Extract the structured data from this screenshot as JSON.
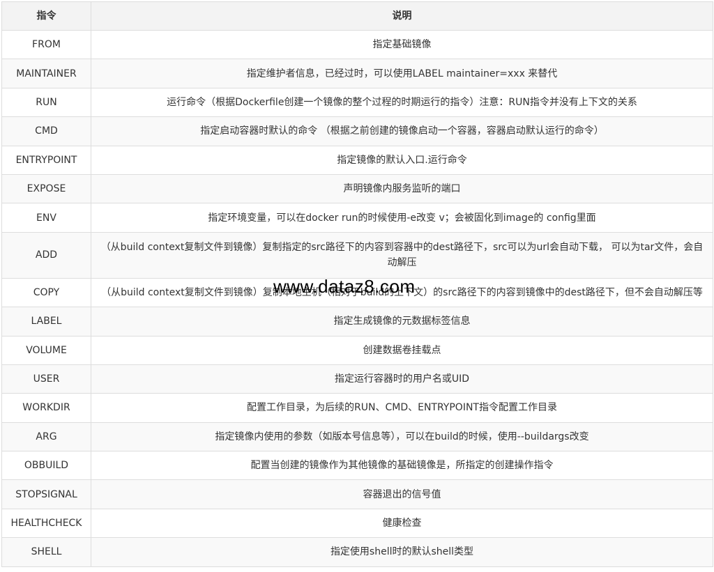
{
  "header": {
    "col1": "指令",
    "col2": "说明"
  },
  "rows": [
    {
      "cmd": "FROM",
      "desc": "指定基础镜像"
    },
    {
      "cmd": "MAINTAINER",
      "desc": "指定维护者信息，已经过时，可以使用LABEL maintainer=xxx 来替代"
    },
    {
      "cmd": "RUN",
      "desc": "运行命令（根据Dockerfile创建一个镜像的整个过程的时期运行的指令）注意：RUN指令并没有上下文的关系"
    },
    {
      "cmd": "CMD",
      "desc": "指定启动容器时默认的命令 （根据之前创建的镜像启动一个容器，容器启动默认运行的命令）"
    },
    {
      "cmd": "ENTRYPOINT",
      "desc": "指定镜像的默认入口.运行命令"
    },
    {
      "cmd": "EXPOSE",
      "desc": "声明镜像内服务监听的端口"
    },
    {
      "cmd": "ENV",
      "desc": "指定环境变量，可以在docker run的时候使用-e改变 v；会被固化到image的 config里面"
    },
    {
      "cmd": "ADD",
      "desc": "（从build context复制文件到镜像）复制指定的src路径下的内容到容器中的dest路径下，src可以为url会自动下载， 可以为tar文件，会自动解压"
    },
    {
      "cmd": "COPY",
      "desc": "（从build context复制文件到镜像）复制本地主机（相对于build的上下文）的src路径下的内容到镜像中的dest路径下，但不会自动解压等"
    },
    {
      "cmd": "LABEL",
      "desc": "指定生成镜像的元数据标签信息"
    },
    {
      "cmd": "VOLUME",
      "desc": "创建数据卷挂载点"
    },
    {
      "cmd": "USER",
      "desc": "指定运行容器时的用户名或UID"
    },
    {
      "cmd": "WORKDIR",
      "desc": "配置工作目录，为后续的RUN、CMD、ENTRYPOINT指令配置工作目录"
    },
    {
      "cmd": "ARG",
      "desc": "指定镜像内使用的参数（如版本号信息等），可以在build的时候，使用--buildargs改变"
    },
    {
      "cmd": "OBBUILD",
      "desc": "配置当创建的镜像作为其他镜像的基础镜像是，所指定的创建操作指令"
    },
    {
      "cmd": "STOPSIGNAL",
      "desc": "容器退出的信号值"
    },
    {
      "cmd": "HEALTHCHECK",
      "desc": "健康检查"
    },
    {
      "cmd": "SHELL",
      "desc": "指定使用shell时的默认shell类型"
    }
  ],
  "watermark": "www.dataz8.com"
}
